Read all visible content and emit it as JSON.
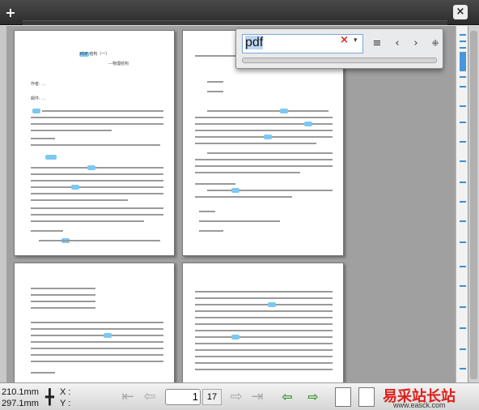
{
  "toolbar": {
    "add_label": "+",
    "close_label": "×"
  },
  "find": {
    "query": "pdf",
    "clear_icon": "×",
    "dropdown_icon": "▾",
    "options_icon": "≡",
    "prev_icon": "‹",
    "next_icon": "›",
    "pin_icon": "⁜"
  },
  "page1": {
    "title": "PDF 结构（一）",
    "subtitle": "—物理结构",
    "author_label": "作者: ...",
    "email_label": "邮件: ..."
  },
  "status": {
    "width": "210.1mm",
    "height": "297.1mm",
    "x_label": "X :",
    "y_label": "Y :",
    "current_page": "1",
    "total_pages": "17"
  },
  "bottom_icons": [
    "first-page",
    "prev-page",
    "next-page",
    "last-page",
    "back",
    "forward",
    "single-page",
    "two-page"
  ],
  "watermark": {
    "text": "易采站长站",
    "url": "www.easck.com"
  }
}
